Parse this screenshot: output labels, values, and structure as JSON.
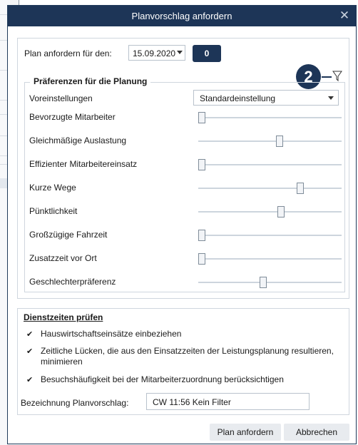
{
  "dialog": {
    "title": "Planvorschlag anfordern",
    "close_symbol": "✕"
  },
  "plan": {
    "label": "Plan anfordern für den:",
    "date": "15.09.2020",
    "count": "0",
    "badge": "2",
    "filter_icon": "filter-icon"
  },
  "preferences": {
    "legend": "Präferenzen für die Planung",
    "preset_label": "Voreinstellungen",
    "preset_value": "Standardeinstellung",
    "sliders": [
      {
        "label": "Bevorzugte Mitarbeiter",
        "value": 0
      },
      {
        "label": "Gleichmäßige Auslastung",
        "value": 0.57
      },
      {
        "label": "Effizienter Mitarbeitereinsatz",
        "value": 0
      },
      {
        "label": "Kurze Wege",
        "value": 0.72
      },
      {
        "label": "Pünktlichkeit",
        "value": 0.58
      },
      {
        "label": "Großzügige Fahrzeit",
        "value": 0
      },
      {
        "label": "Zusatzzeit vor Ort",
        "value": 0
      },
      {
        "label": "Geschlechterpräferenz",
        "value": 0.45
      }
    ]
  },
  "dienstzeiten": {
    "title": "Dienstzeiten prüfen",
    "checkboxes": [
      {
        "label": "Hauswirtschaftseinsätze einbeziehen",
        "checked": true
      },
      {
        "label": "Zeitliche Lücken, die aus den Einsatzzeiten der Leistungsplanung resultieren,",
        "label2": "minimieren",
        "checked": true
      },
      {
        "label": "Besuchshäufigkeit bei der Mitarbeiterzuordnung berücksichtigen",
        "checked": true
      }
    ],
    "bezeichnung_label": "Bezeichnung Planvorschlag:",
    "bezeichnung_value": "CW 11:56 Kein Filter"
  },
  "buttons": {
    "submit": "Plan anfordern",
    "cancel": "Abbrechen"
  },
  "colors": {
    "titlebar": "#1d3557",
    "accent": "#1d3557"
  }
}
